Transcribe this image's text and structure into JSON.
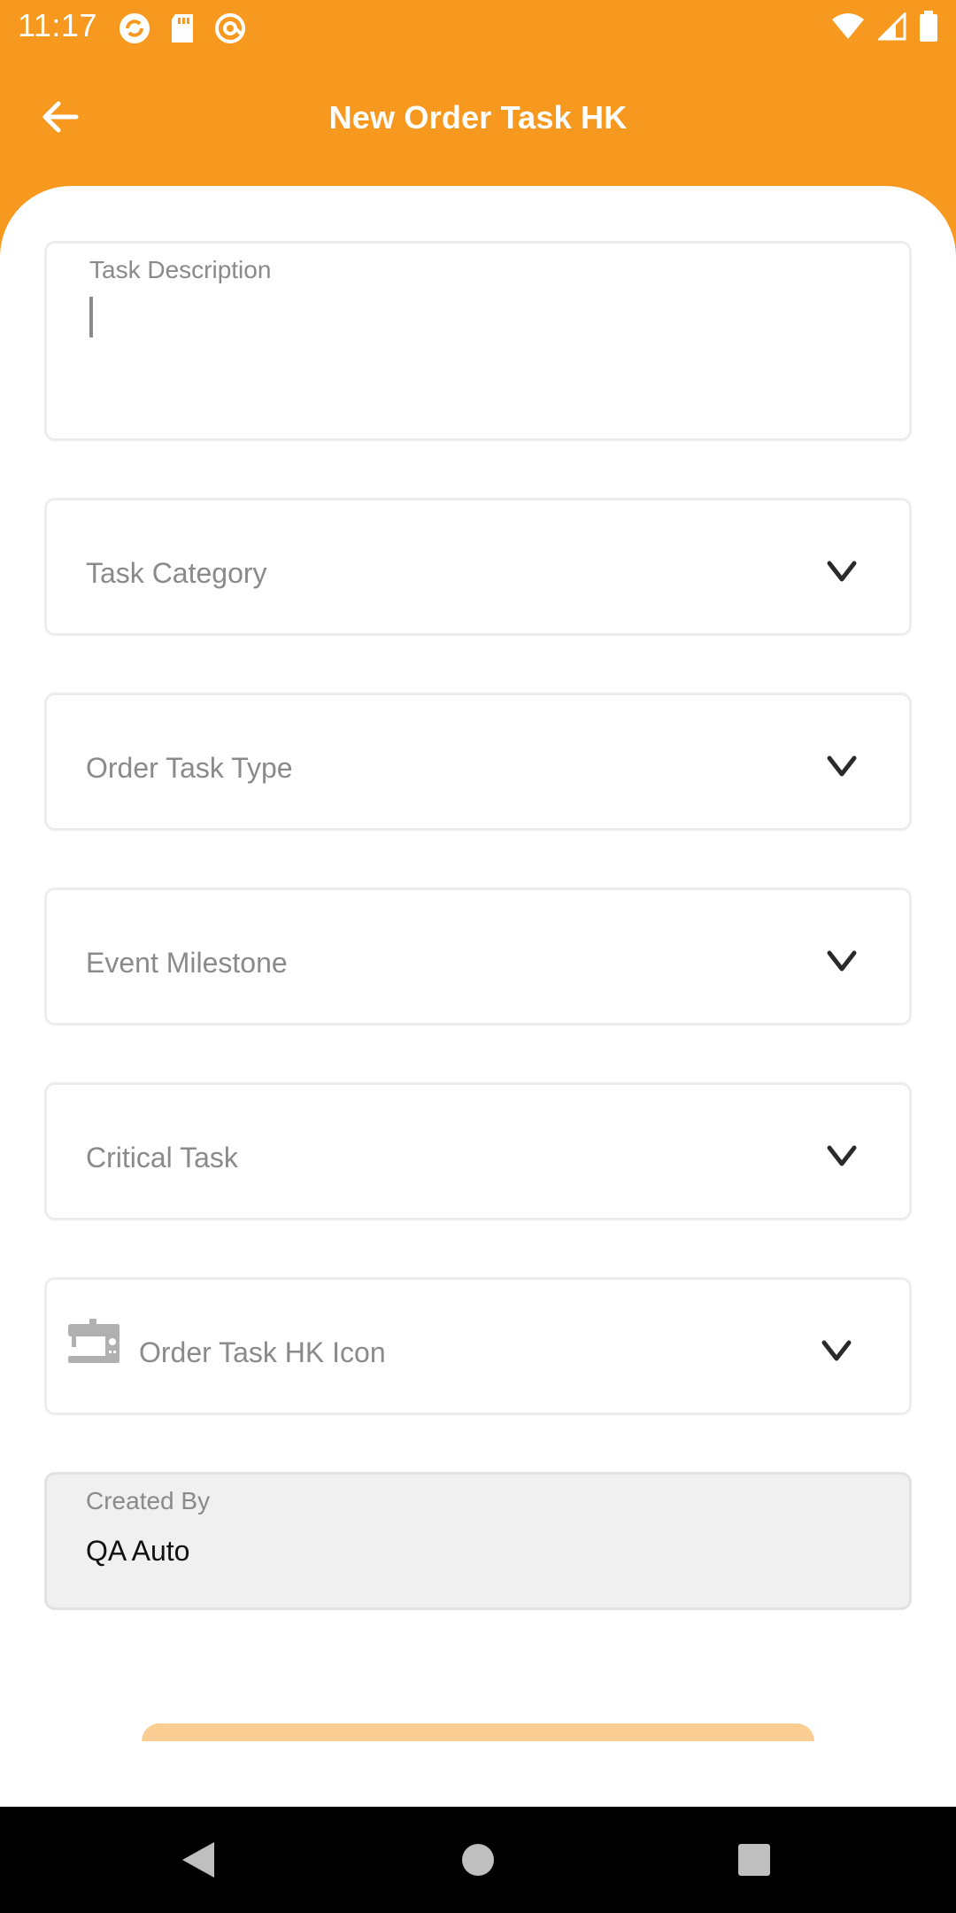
{
  "status_bar": {
    "time": "11:17"
  },
  "app_bar": {
    "title": "New Order Task HK",
    "back_icon": "arrow-left-icon"
  },
  "form": {
    "task_description": {
      "label": "Task Description",
      "value": ""
    },
    "dropdowns": [
      {
        "label": "Task Category",
        "icon": "chevron-down-icon"
      },
      {
        "label": "Order Task Type",
        "icon": "chevron-down-icon"
      },
      {
        "label": "Event Milestone",
        "icon": "chevron-down-icon"
      },
      {
        "label": "Critical Task",
        "icon": "chevron-down-icon"
      },
      {
        "label": "Order Task HK Icon",
        "icon": "chevron-down-icon",
        "leading_icon": "sewing-machine-icon"
      }
    ],
    "created_by": {
      "label": "Created By",
      "value": "QA Auto"
    }
  },
  "colors": {
    "accent": "#f8991f",
    "accent_light": "#fbcd93",
    "border": "#ececec",
    "label": "#8a8a8a"
  }
}
